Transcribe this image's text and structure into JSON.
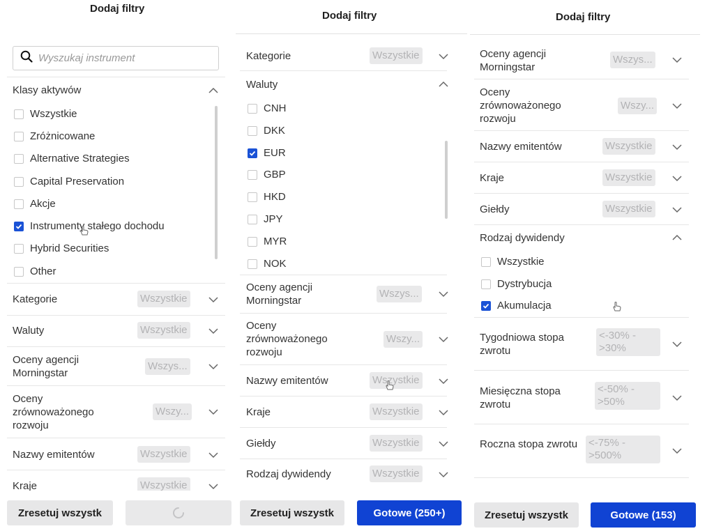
{
  "colors": {
    "accent": "#1043d3",
    "pill_bg": "#e9e9ea",
    "pill_text": "#b3b3b5"
  },
  "panel1": {
    "title": "Dodaj filtry",
    "search_placeholder": "Wyszukaj instrument",
    "asset_classes": {
      "label": "Klasy aktywów",
      "options": [
        {
          "label": "Wszystkie",
          "checked": false
        },
        {
          "label": "Zróżnicowane",
          "checked": false
        },
        {
          "label": "Alternative Strategies",
          "checked": false
        },
        {
          "label": "Capital Preservation",
          "checked": false
        },
        {
          "label": "Akcje",
          "checked": false
        },
        {
          "label": "Instrumenty stałego dochodu",
          "checked": true
        },
        {
          "label": "Hybrid Securities",
          "checked": false
        },
        {
          "label": "Other",
          "checked": false
        }
      ]
    },
    "filters": [
      {
        "label": "Kategorie",
        "value": "Wszystkie"
      },
      {
        "label": "Waluty",
        "value": "Wszystkie"
      },
      {
        "label": "Oceny agencji Morningstar",
        "value": "Wszys..."
      },
      {
        "label": "Oceny zrównoważonego rozwoju",
        "value": "Wszy..."
      },
      {
        "label": "Nazwy emitentów",
        "value": "Wszystkie"
      },
      {
        "label": "Kraje",
        "value": "Wszystkie"
      }
    ],
    "reset_label": "Zresetuj wszystk"
  },
  "panel2": {
    "title": "Dodaj filtry",
    "category": {
      "label": "Kategorie",
      "value": "Wszystkie"
    },
    "currencies": {
      "label": "Waluty",
      "options": [
        {
          "label": "CNH",
          "checked": false
        },
        {
          "label": "DKK",
          "checked": false
        },
        {
          "label": "EUR",
          "checked": true
        },
        {
          "label": "GBP",
          "checked": false
        },
        {
          "label": "HKD",
          "checked": false
        },
        {
          "label": "JPY",
          "checked": false
        },
        {
          "label": "MYR",
          "checked": false
        },
        {
          "label": "NOK",
          "checked": false
        }
      ]
    },
    "filters": [
      {
        "label": "Oceny agencji Morningstar",
        "value": "Wszys..."
      },
      {
        "label": "Oceny zrównoważonego rozwoju",
        "value": "Wszy..."
      },
      {
        "label": "Nazwy emitentów",
        "value": "Wszystkie"
      },
      {
        "label": "Kraje",
        "value": "Wszystkie"
      },
      {
        "label": "Giełdy",
        "value": "Wszystkie"
      },
      {
        "label": "Rodzaj dywidendy",
        "value": "Wszystkie"
      }
    ],
    "reset_label": "Zresetuj wszystk",
    "done_label": "Gotowe (250+)"
  },
  "panel3": {
    "title": "Dodaj filtry",
    "filters": [
      {
        "label": "Oceny agencji Morningstar",
        "value": "Wszys..."
      },
      {
        "label": "Oceny zrównoważonego rozwoju",
        "value": "Wszy..."
      },
      {
        "label": "Nazwy emitentów",
        "value": "Wszystkie"
      },
      {
        "label": "Kraje",
        "value": "Wszystkie"
      },
      {
        "label": "Giełdy",
        "value": "Wszystkie"
      }
    ],
    "dividend": {
      "label": "Rodzaj dywidendy",
      "options": [
        {
          "label": "Wszystkie",
          "checked": false
        },
        {
          "label": "Dystrybucja",
          "checked": false
        },
        {
          "label": "Akumulacja",
          "checked": true
        }
      ]
    },
    "returns": [
      {
        "label": "Tygodniowa stopa zwrotu",
        "value": "<-30% - >30%"
      },
      {
        "label": "Miesięczna stopa zwrotu",
        "value": "<-50% - >50%"
      },
      {
        "label": "Roczna stopa zwrotu",
        "value": "<-75% - >500%"
      }
    ],
    "reset_label": "Zresetuj wszystk",
    "done_label": "Gotowe (153)"
  }
}
